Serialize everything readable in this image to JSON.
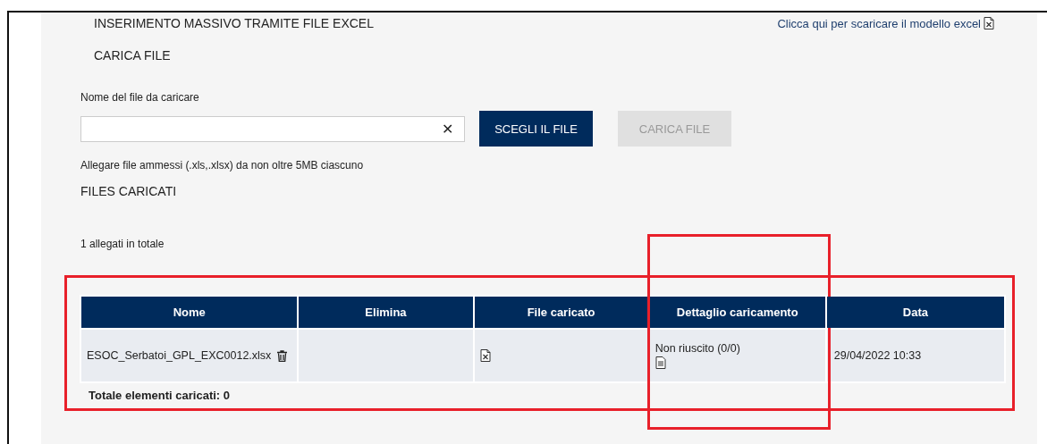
{
  "header": {
    "title": "INSERIMENTO MASSIVO TRAMITE FILE EXCEL",
    "template_link": "Clicca qui per scaricare il modello excel"
  },
  "upload": {
    "section_title": "CARICA FILE",
    "field_label": "Nome del file da caricare",
    "clear_symbol": "✕",
    "buttons": [
      {
        "label": "SCEGLI IL FILE",
        "disabled": false
      },
      {
        "label": "CARICA FILE",
        "disabled": true
      }
    ],
    "hint": "Allegare file ammessi (.xls,.xlsx) da non oltre 5MB ciascuno"
  },
  "files": {
    "section_title": "FILES CARICATI",
    "count": "1 allegati in totale",
    "highlighted": true,
    "columns": [
      {
        "label": "Nome",
        "highlighted": false
      },
      {
        "label": "Elimina",
        "highlighted": false
      },
      {
        "label": "File caricato",
        "highlighted": false
      },
      {
        "label": "Dettaglio caricamento",
        "highlighted": true
      },
      {
        "label": "Data",
        "highlighted": false
      }
    ],
    "rows": [
      {
        "name": "ESOC_Serbatoi_GPL_EXC0012.xlsx",
        "detail": "Non riuscito (0/0)",
        "date": "29/04/2022 10:33"
      }
    ],
    "total": "Totale elementi caricati: 0"
  }
}
